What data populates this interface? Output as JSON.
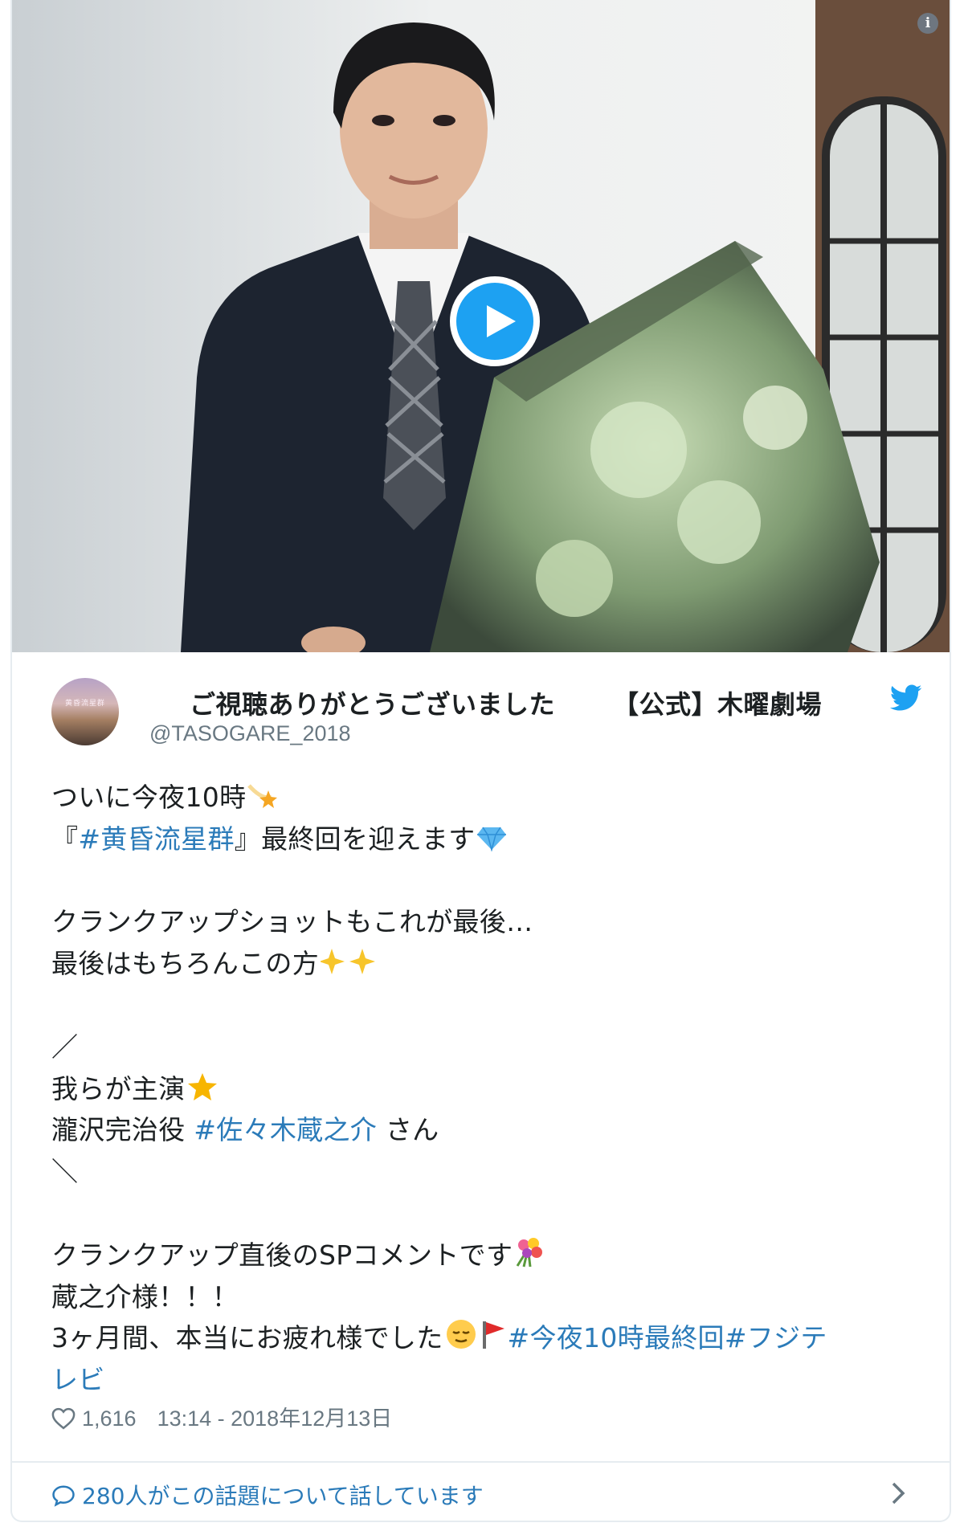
{
  "media": {
    "info_icon": "i",
    "play_icon": "play-icon"
  },
  "author": {
    "display_name_left": "ご視聴ありがとうございました",
    "display_name_right": "【公式】木曜劇場",
    "handle": "@TASOGARE_2018",
    "avatar_text": "黄昏流星群",
    "verified_icon": "twitter-bird-icon"
  },
  "tweet": {
    "l1": "ついに今夜10時",
    "l2_pre": "『",
    "l2_tag": "#黄昏流星群",
    "l2_post": "』最終回を迎えます",
    "l3": "クランクアップショットもこれが最後…",
    "l4": "最後はもちろんこの方",
    "l5": "／",
    "l6": "我らが主演",
    "l7_pre": "瀧沢完治役 ",
    "l7_tag": "#佐々木蔵之介",
    "l7_post": " さん",
    "l8": "＼",
    "l9": "クランクアップ直後のSPコメントです",
    "l10": "蔵之介様！！！",
    "l11_pre": "3ヶ月間、本当にお疲れ様でした",
    "l11_tag1": "#今夜10時最終回",
    "l11_tag2": "#フジテ",
    "l12_tag": "レビ"
  },
  "meta": {
    "like_count": "1,616",
    "timestamp": "13:14 - 2018年12月13日"
  },
  "footer": {
    "conversation": "280人がこの話題について話しています"
  },
  "colors": {
    "link": "#2b7bb9",
    "twitter_blue": "#1da1f2",
    "muted": "#697882"
  }
}
